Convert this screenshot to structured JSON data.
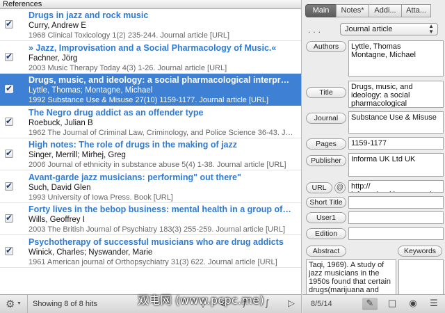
{
  "left_pane": {
    "header": "References",
    "references": [
      {
        "title": "Drugs in jazz and rock music",
        "authors": "Curry, Andrew E",
        "citation": "1968 Clinical Toxicology 1(2) 235-244. Journal article  [URL]",
        "checked": true,
        "selected": false
      },
      {
        "title": "» Jazz, Improvisation and a Social Pharmacology of Music.«",
        "authors": "Fachner, Jörg",
        "citation": "2003 Music Therapy Today 4(3) 1-26. Journal article  [URL]",
        "checked": true,
        "selected": false
      },
      {
        "title": "Drugs, music, and ideology: a social pharmacological interpr…",
        "authors": "Lyttle, Thomas; Montagne, Michael",
        "citation": "1992 Substance Use & Misuse 27(10) 1159-1177. Journal article  [URL]",
        "checked": true,
        "selected": true
      },
      {
        "title": "The Negro drug addict as an offender type",
        "authors": "Roebuck, Julian B",
        "citation": "1962 The Journal of Criminal Law, Criminology, and Police Science  36-43. J…",
        "checked": true,
        "selected": false
      },
      {
        "title": "High notes: The role of drugs in the making of jazz",
        "authors": "Singer, Merrill; Mirhej, Greg",
        "citation": "2006 Journal of ethnicity in substance abuse 5(4) 1-38. Journal article  [URL]",
        "checked": true,
        "selected": false
      },
      {
        "title": "Avant-garde jazz musicians: performing\" out there\"",
        "authors": "Such, David Glen",
        "citation": "1993 University of Iowa Press. Book  [URL]",
        "checked": true,
        "selected": false
      },
      {
        "title": "Forty lives in the bebop business: mental health in a group of…",
        "authors": "Wills, Geoffrey I",
        "citation": "2003 The British Journal of Psychiatry 183(3) 255-259. Journal article  [URL]",
        "checked": true,
        "selected": false
      },
      {
        "title": "Psychotherapy of successful musicians who are drug addicts",
        "authors": "Winick, Charles; Nyswander, Marie",
        "citation": "1961 American journal of Orthopsychiatry 31(3) 622. Journal article  [URL]",
        "checked": true,
        "selected": false
      }
    ],
    "footer": {
      "gear_icon": "⚙",
      "hits": "Showing 8 of 8 hits"
    }
  },
  "right_pane": {
    "tabs": [
      "Main",
      "Notes*",
      "Addi...",
      "Atta..."
    ],
    "dots": "...",
    "ref_type": "Journal article",
    "fields": {
      "authors_label": "Authors",
      "authors_value": "Lyttle, Thomas\nMontagne, Michael",
      "title_label": "Title",
      "title_value": "Drugs, music, and ideology: a social pharmacological",
      "journal_label": "Journal",
      "journal_value": "Substance Use & Misuse",
      "pages_label": "Pages",
      "pages_value": "1159-1177",
      "publisher_label": "Publisher",
      "publisher_value": "Informa UK Ltd UK",
      "url_label": "URL",
      "url_at": "@",
      "url_value": "http://\ninformahealthcare.com/",
      "short_title_label": "Short Title",
      "short_title_value": "",
      "user1_label": "User1",
      "user1_value": "",
      "edition_label": "Edition",
      "edition_value": ""
    },
    "abstract_label": "Abstract",
    "keywords_label": "Keywords",
    "abstract_text": "Taqi, 1969). A study of jazz musicians in the 1950s found that certain drugs(marijuana and",
    "footer": {
      "counter": "8/5/14"
    }
  },
  "watermark": "双电网 (www.pcpc.me)",
  "colors": {
    "selection": "#3d80d4",
    "title_blue": "#2e7bd6"
  }
}
